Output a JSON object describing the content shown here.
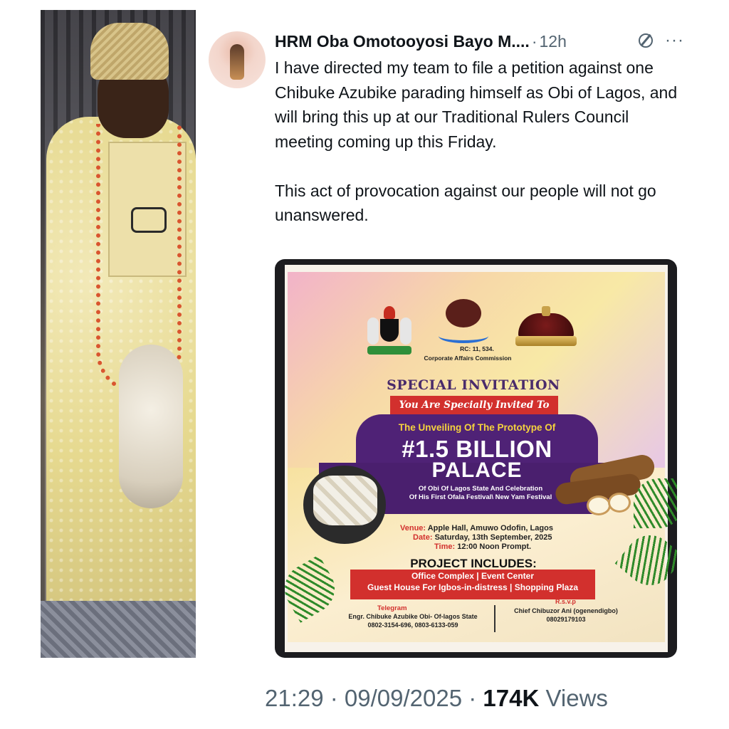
{
  "tweet": {
    "author_name": "HRM Oba Omotooyosi Bayo M....",
    "separator": "·",
    "time_ago": "12h",
    "more": "···",
    "body": "I have directed my team to file a petition against one Chibuke Azubike parading himself as Obi of Lagos, and will bring this up at our Traditional Rulers Council meeting coming up this Friday.\n\nThis act of provocation against our people will not go unanswered."
  },
  "flyer": {
    "rc": "RC: 11, 534.",
    "cac": "Corporate Affairs Commission",
    "special": "SPECIAL INVITATION",
    "invited": "You Are Specially Invited To",
    "unveil": "The Unveiling Of The Prototype Of",
    "amount": "#1.5 BILLION",
    "palace": "PALACE",
    "of_obi_1": "Of Obi Of Lagos State And Celebration",
    "of_obi_2": "Of His First Ofala Festival\\ New Yam Festival",
    "venue_label": "Venue:",
    "venue_value": "Apple Hall, Amuwo Odofin, Lagos",
    "date_label": "Date:",
    "date_value": "Saturday, 13th September, 2025",
    "time_label": "Time:",
    "time_value": "12:00 Noon Prompt.",
    "project": "PROJECT INCLUDES:",
    "includes_1": "Office Complex | Event Center",
    "includes_2": "Guest House For Igbos-in-distress | Shopping Plaza",
    "telegram_label": "Telegram",
    "telegram_1": "Engr. Chibuke Azubike Obi- Of-lagos State",
    "telegram_2": "0802-3154-696, 0803-6133-059",
    "rsvp_label": "R.s.v.p",
    "rsvp_1": "Chief Chibuzor Ani (ogenendigbo)",
    "rsvp_2": "08029179103"
  },
  "footer": {
    "timestamp": "21:29 · 09/09/2025 ·",
    "views_count": "174K",
    "views_label": "Views"
  },
  "colors": {
    "text_primary": "#0f1419",
    "text_secondary": "#536471",
    "flyer_red": "#d2302d",
    "flyer_purple": "#4f2276"
  },
  "icons": [
    "grok-icon",
    "more-icon"
  ]
}
